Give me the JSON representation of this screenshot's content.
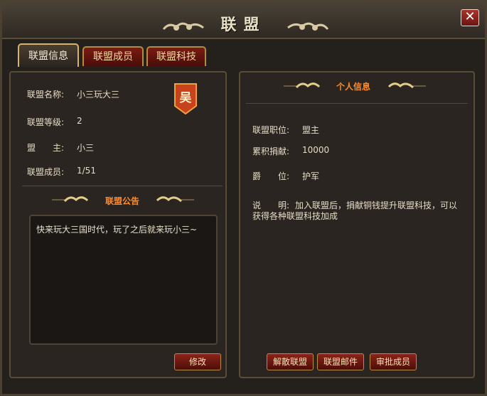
{
  "window": {
    "title": "联盟"
  },
  "tabs": [
    {
      "label": "联盟信息"
    },
    {
      "label": "联盟成员"
    },
    {
      "label": "联盟科技"
    }
  ],
  "left": {
    "name_label": "联盟名称:",
    "name_value": "小三玩大三",
    "level_label": "联盟等级:",
    "level_value": "2",
    "leader_label": "盟　　主:",
    "leader_value": "小三",
    "members_label": "联盟成员:",
    "members_value": "1/51",
    "emblem_char": "吴",
    "notice_title": "联盟公告",
    "notice_text": "快来玩大三国时代，玩了之后就来玩小三~",
    "edit_button": "修改"
  },
  "right": {
    "title": "个人信息",
    "position_label": "联盟职位:",
    "position_value": "盟主",
    "contribution_label": "累积捐献:",
    "contribution_value": "10000",
    "rank_label": "爵　　位:",
    "rank_value": "护军",
    "desc_label": "说　　明:",
    "desc_text_1": "加入联盟后，捐献铜钱提升联盟科技，可以",
    "desc_text_2": "获得各种联盟科技加成",
    "buttons": {
      "disband": "解散联盟",
      "mail": "联盟邮件",
      "approve": "审批成员"
    }
  },
  "icons": {
    "close": "close-icon",
    "cloud": "cloud-ornament-icon",
    "emblem": "banner-emblem-icon"
  }
}
